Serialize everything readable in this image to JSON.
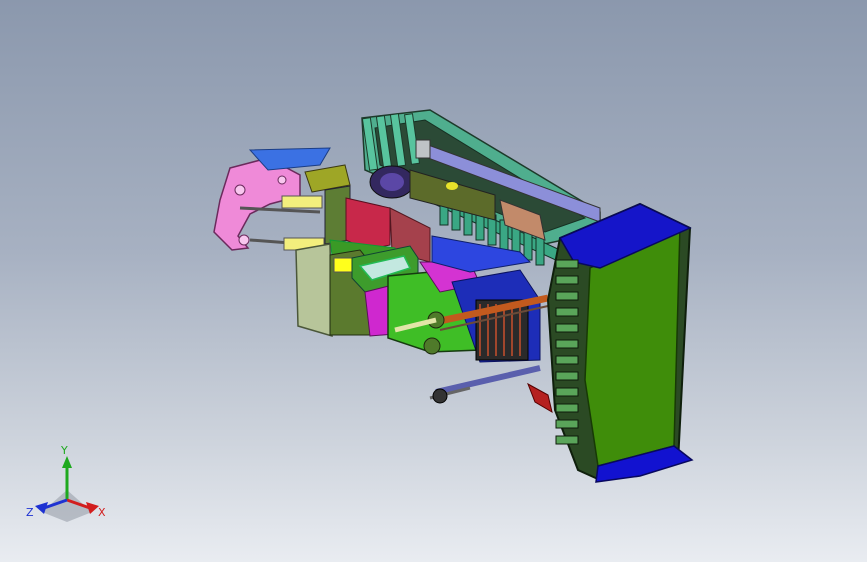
{
  "viewport": {
    "background_top": "#8b98ad",
    "background_bottom": "#e9ecf1"
  },
  "model": {
    "palette": {
      "track": "#2a4c36",
      "track_links": "#48a98a",
      "frame": "#2f4a2c",
      "blade": "#3a8a10",
      "blade_ends": "#1010c8",
      "pink_ripper": "#e87fd2",
      "yellow": "#f4f12a",
      "olive": "#b9c79a",
      "magenta": "#d12bd0",
      "red": "#b4223c",
      "orange": "#d06a2b"
    }
  },
  "triad": {
    "x_label": "X",
    "y_label": "Y",
    "z_label": "Z",
    "x_color": "#d21e1e",
    "y_color": "#1ea91e",
    "z_color": "#1e32d2"
  }
}
